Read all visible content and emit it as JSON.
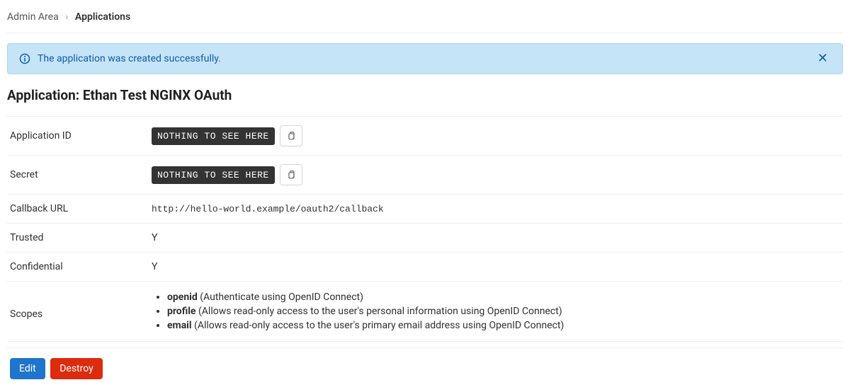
{
  "breadcrumb": {
    "root": "Admin Area",
    "current": "Applications"
  },
  "alert": {
    "message": "The application was created successfully."
  },
  "title": "Application: Ethan Test NGINX OAuth",
  "fields": {
    "app_id_label": "Application ID",
    "app_id_value": "NOTHING TO SEE HERE",
    "secret_label": "Secret",
    "secret_value": "NOTHING TO SEE HERE",
    "callback_label": "Callback URL",
    "callback_value": "http://hello-world.example/oauth2/callback",
    "trusted_label": "Trusted",
    "trusted_value": "Y",
    "confidential_label": "Confidential",
    "confidential_value": "Y",
    "scopes_label": "Scopes"
  },
  "scopes": [
    {
      "name": "openid",
      "desc": "(Authenticate using OpenID Connect)"
    },
    {
      "name": "profile",
      "desc": "(Allows read-only access to the user's personal information using OpenID Connect)"
    },
    {
      "name": "email",
      "desc": "(Allows read-only access to the user's primary email address using OpenID Connect)"
    }
  ],
  "buttons": {
    "edit": "Edit",
    "destroy": "Destroy"
  }
}
